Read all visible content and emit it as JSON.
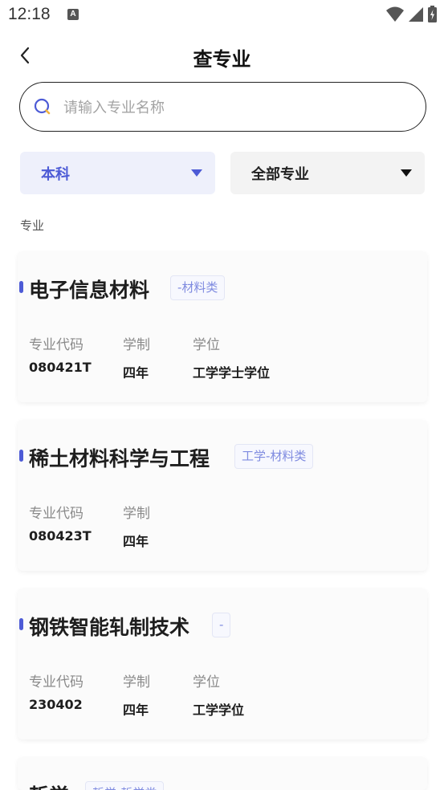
{
  "status_bar": {
    "time": "12:18",
    "notification_badge": "A"
  },
  "header": {
    "title": "查专业"
  },
  "search": {
    "placeholder": "请输入专业名称"
  },
  "filters": {
    "level": "本科",
    "major": "全部专业"
  },
  "section_label": "专业",
  "majors": [
    {
      "name": "电子信息材料",
      "category": "-材料类",
      "code_label": "专业代码",
      "code": "080421T",
      "duration_label": "学制",
      "duration": "四年",
      "degree_label": "学位",
      "degree": "工学学士学位"
    },
    {
      "name": "稀土材料科学与工程",
      "category": "工学-材料类",
      "code_label": "专业代码",
      "code": "080423T",
      "duration_label": "学制",
      "duration": "四年"
    },
    {
      "name": "钢铁智能轧制技术",
      "category": "-",
      "code_label": "专业代码",
      "code": "230402",
      "duration_label": "学制",
      "duration": "四年",
      "degree_label": "学位",
      "degree": "工学学位"
    },
    {
      "name": "哲学",
      "category": "哲学-哲学类"
    }
  ],
  "colors": {
    "accent": "#4d5bd6",
    "tag_text": "#7f8be0",
    "filter_active_bg": "#eef0fb"
  }
}
